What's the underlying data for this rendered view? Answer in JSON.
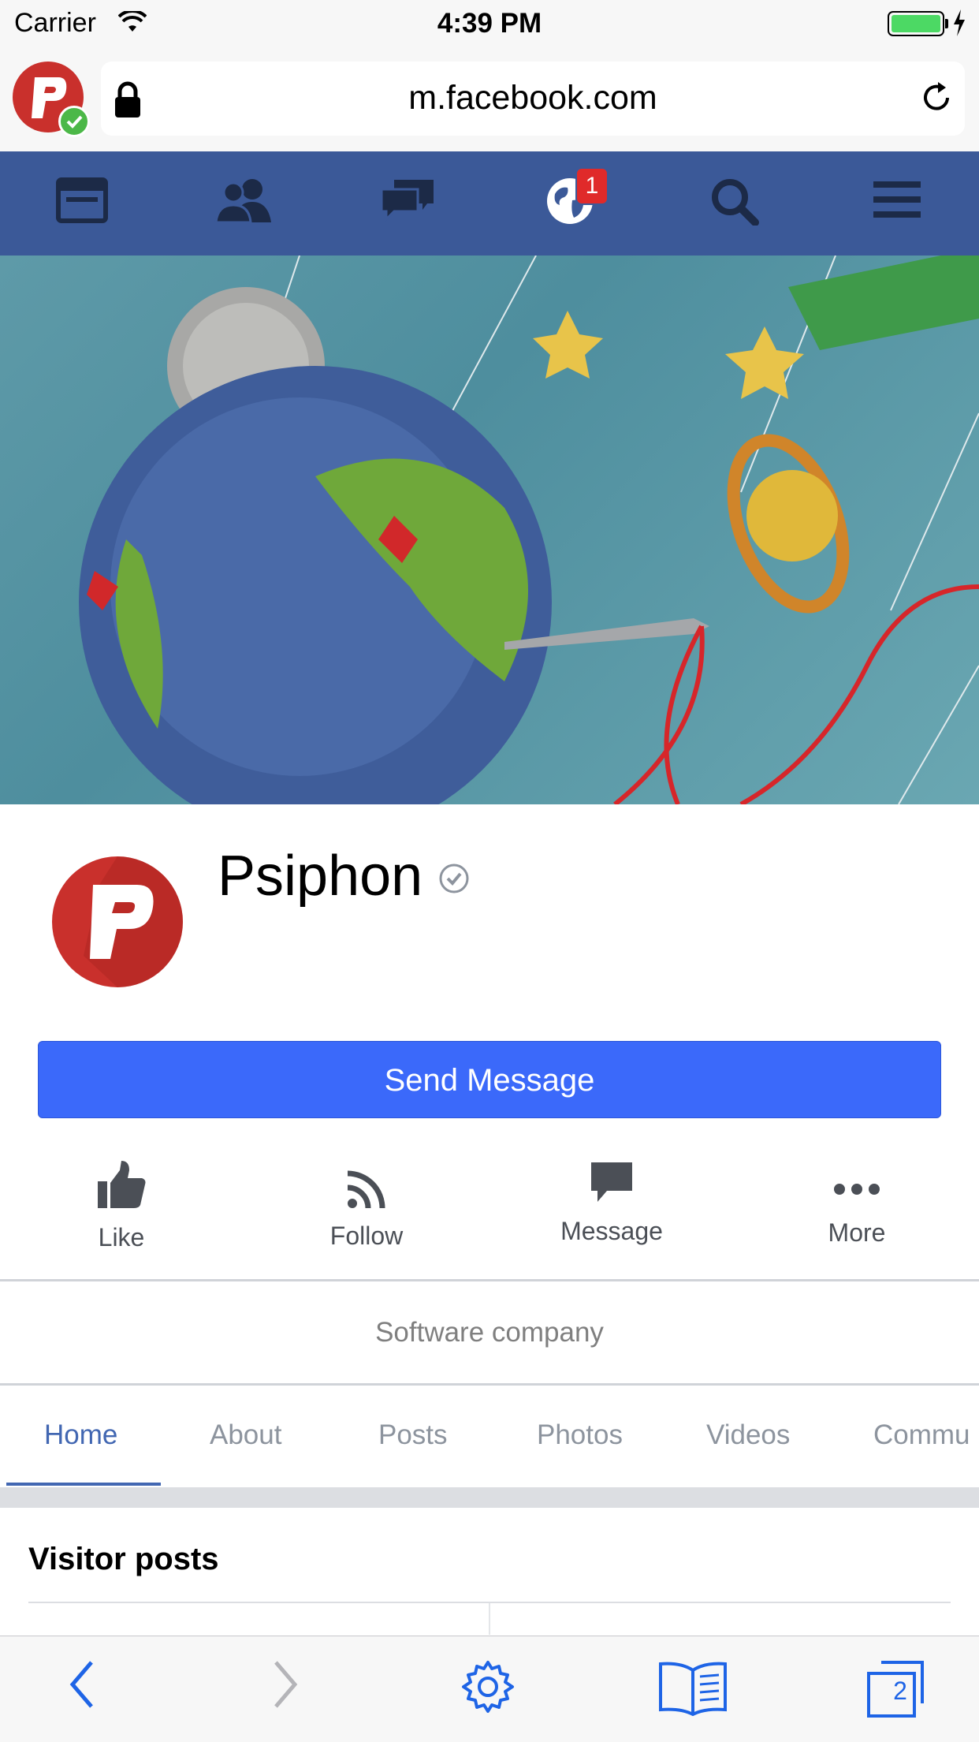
{
  "status_bar": {
    "carrier": "Carrier",
    "time": "4:39 PM"
  },
  "browser": {
    "url": "m.facebook.com",
    "tabs_count": "2"
  },
  "fb_nav": {
    "notification_count": "1"
  },
  "page": {
    "name": "Psiphon",
    "send_message_label": "Send Message",
    "category": "Software company"
  },
  "actions": [
    {
      "label": "Like",
      "icon": "like-icon"
    },
    {
      "label": "Follow",
      "icon": "follow-icon"
    },
    {
      "label": "Message",
      "icon": "message-icon"
    },
    {
      "label": "More",
      "icon": "more-icon"
    }
  ],
  "tabs": [
    {
      "label": "Home",
      "active": true
    },
    {
      "label": "About"
    },
    {
      "label": "Posts"
    },
    {
      "label": "Photos"
    },
    {
      "label": "Videos"
    },
    {
      "label": "Commu"
    }
  ],
  "visitor_posts": {
    "title": "Visitor posts"
  },
  "colors": {
    "fb_blue": "#3b5998",
    "send_button": "#3b69fa",
    "active_tab": "#4267b2",
    "psiphon_red": "#c9302c",
    "toolbar_blue": "#1e64e6"
  }
}
